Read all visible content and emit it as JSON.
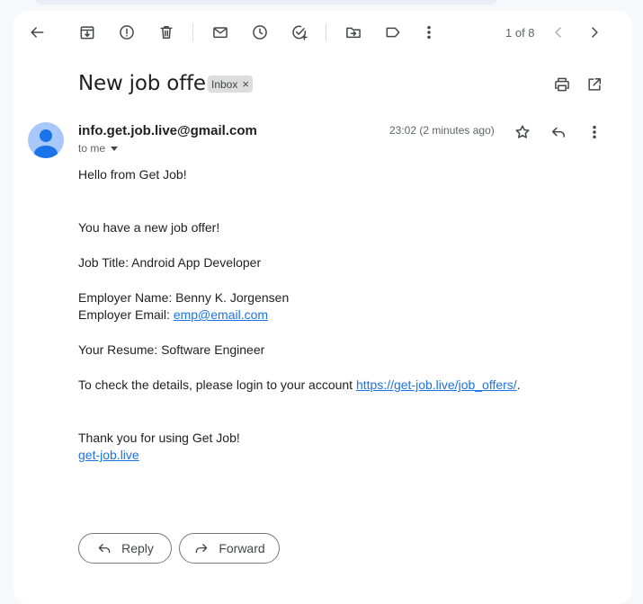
{
  "toolbar": {
    "icons": [
      "back-arrow-icon",
      "archive-icon",
      "report-spam-icon",
      "delete-icon",
      "mark-unread-icon",
      "snooze-icon",
      "add-to-tasks-icon",
      "move-to-icon",
      "labels-icon",
      "more-vert-icon"
    ],
    "counter": "1 of 8"
  },
  "email": {
    "subject": "New job offer",
    "label": "Inbox",
    "label_remove": "×",
    "sender": "info.get.job.live@gmail.com",
    "recipient": "to me",
    "timestamp": "23:02 (2 minutes ago)",
    "body": {
      "greeting": "Hello from Get Job!",
      "intro": "You have a new job offer!",
      "job_title": "Job Title: Android App Developer",
      "employer_name": "Employer Name: Benny K. Jorgensen",
      "employer_email_prefix": "Employer Email: ",
      "employer_email_link": "emp@email.com",
      "resume": "Your Resume: Software Engineer",
      "details_prefix": "To check the details, please login to your account ",
      "details_link": "https://get-job.live/job_offers/",
      "details_suffix": ".",
      "thanks": "Thank you for using Get Job!",
      "site_link": "get-job.live"
    }
  },
  "actions": {
    "reply": "Reply",
    "forward": "Forward"
  },
  "colors": {
    "link": "#1a73e8",
    "avatar_bg": "#a8c7fa",
    "avatar_fg": "#1a73e8",
    "panel_bg": "#ffffff",
    "page_bg": "#f6f8fc"
  }
}
